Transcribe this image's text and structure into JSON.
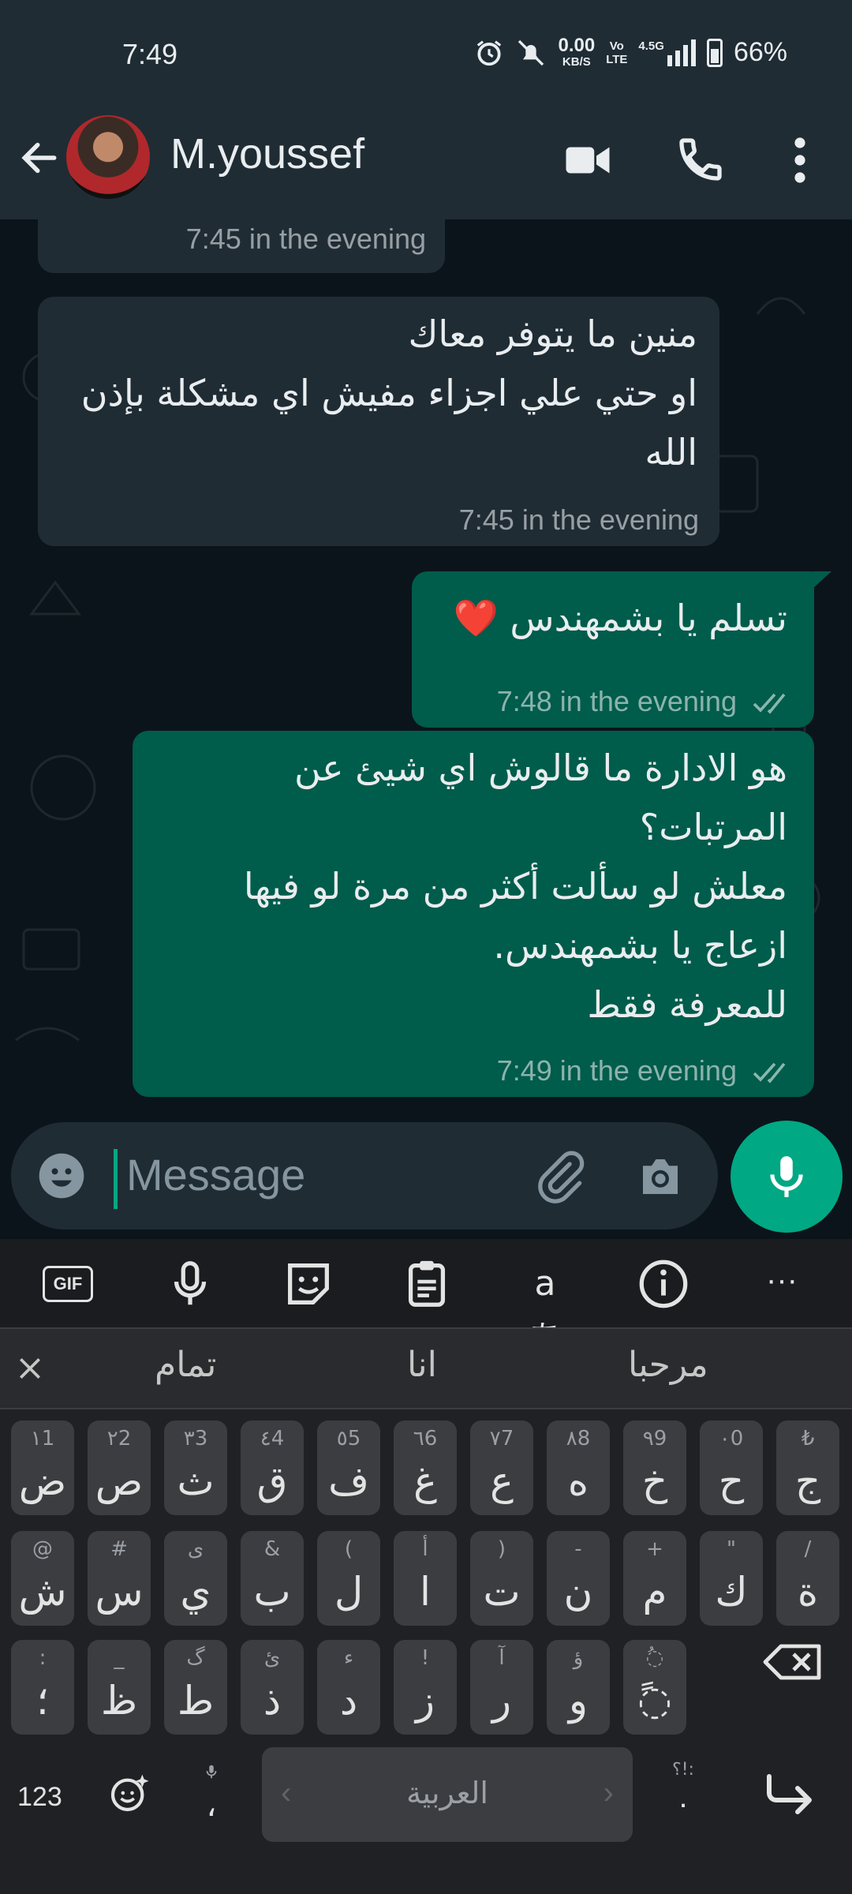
{
  "status_bar": {
    "time": "7:49",
    "net_speed_value": "0.00",
    "net_speed_unit": "KB/S",
    "volte_top": "Vo",
    "volte_bottom": "LTE",
    "network": "4.5G",
    "battery": "66%"
  },
  "header": {
    "contact_name": "M.youssef"
  },
  "messages": [
    {
      "direction": "in",
      "text": "",
      "time": "7:45 in the evening"
    },
    {
      "direction": "in",
      "text": "منين ما يتوفر معاك\nاو حتي علي اجزاء مفيش اي مشكلة بإذن الله",
      "time": "7:45 in the evening"
    },
    {
      "direction": "out",
      "text": "تسلم يا بشمهندس ❤️",
      "time": "7:48 in the evening"
    },
    {
      "direction": "out",
      "text": "هو الادارة ما قالوش اي شيئ عن المرتبات؟\nمعلش لو سألت أكثر من مرة لو فيها ازعاج يا بشمهندس.\nللمعرفة فقط",
      "time": "7:49 in the evening"
    }
  ],
  "composer": {
    "placeholder": "Message"
  },
  "keyboard": {
    "tools": [
      "gif-icon",
      "mic-icon",
      "sticker-icon",
      "clipboard-icon",
      "translate-icon",
      "info-icon",
      "more-icon"
    ],
    "gif_label": "GIF",
    "translate_label": "aあ",
    "more_label": "···",
    "suggestions": [
      "تمام",
      "انا",
      "مرحبا"
    ],
    "row1": [
      {
        "main": "ض",
        "hint": "١1"
      },
      {
        "main": "ص",
        "hint": "٢2"
      },
      {
        "main": "ث",
        "hint": "٣3"
      },
      {
        "main": "ق",
        "hint": "٤4"
      },
      {
        "main": "ف",
        "hint": "٥5"
      },
      {
        "main": "غ",
        "hint": "٦6"
      },
      {
        "main": "ع",
        "hint": "٧7"
      },
      {
        "main": "ه",
        "hint": "٨8"
      },
      {
        "main": "خ",
        "hint": "٩9"
      },
      {
        "main": "ح",
        "hint": "٠0"
      },
      {
        "main": "ج",
        "hint": "₺"
      }
    ],
    "row2": [
      {
        "main": "ش",
        "hint": "@"
      },
      {
        "main": "س",
        "hint": "#"
      },
      {
        "main": "ي",
        "hint": "ى"
      },
      {
        "main": "ب",
        "hint": "&"
      },
      {
        "main": "ل",
        "hint": "("
      },
      {
        "main": "ا",
        "hint": "أ"
      },
      {
        "main": "ت",
        "hint": ")"
      },
      {
        "main": "ن",
        "hint": "-"
      },
      {
        "main": "م",
        "hint": "+"
      },
      {
        "main": "ك",
        "hint": "\""
      },
      {
        "main": "ة",
        "hint": "/"
      }
    ],
    "row3": [
      {
        "main": "؛",
        "hint": ":"
      },
      {
        "main": "ظ",
        "hint": "_"
      },
      {
        "main": "ط",
        "hint": "گ"
      },
      {
        "main": "ذ",
        "hint": "ئ"
      },
      {
        "main": "د",
        "hint": "ء"
      },
      {
        "main": "ز",
        "hint": "!"
      },
      {
        "main": "ر",
        "hint": "آ"
      },
      {
        "main": "و",
        "hint": "ؤ"
      },
      {
        "main": "◌ً",
        "hint": "◌ُ"
      }
    ],
    "numbers_key": "123",
    "comma_key": "،",
    "period_key": ".",
    "period_hint": "؟!:",
    "space_label": "العربية"
  }
}
